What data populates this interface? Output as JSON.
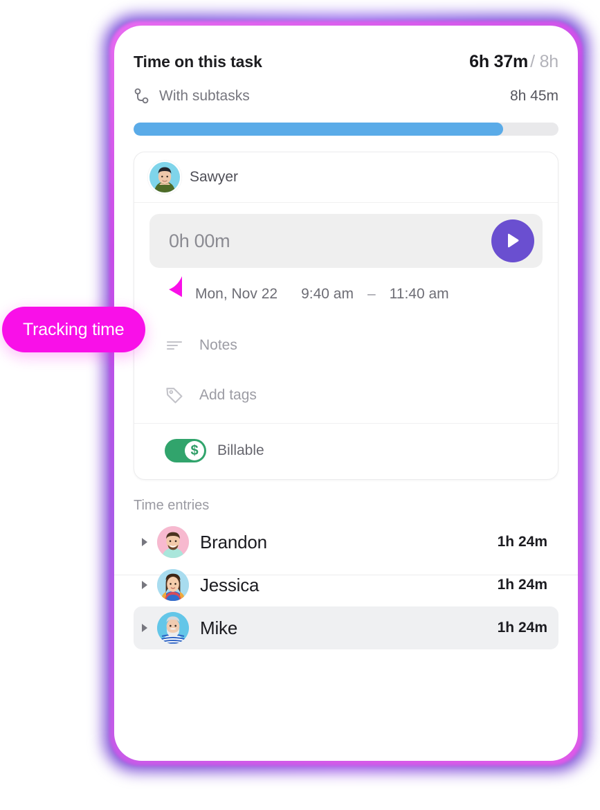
{
  "header": {
    "title": "Time on this task",
    "time_spent": "6h 37m",
    "time_estimate": "/ 8h",
    "subtasks_label": "With subtasks",
    "subtasks_total": "8h 45m",
    "subtasks_icon": "subtask-branch-icon"
  },
  "progress": {
    "percent": 87,
    "fill_color": "#5aabe8",
    "track_color": "#e9e9eb"
  },
  "active_entry": {
    "user": "Sawyer",
    "timer_value": "0h 00m",
    "play_icon": "play-icon",
    "play_button_color": "#6a4fd0",
    "date": "Mon, Nov 22",
    "start_time": "9:40 am",
    "dash": "–",
    "end_time": "11:40 am",
    "notes_label": "Notes",
    "notes_icon": "notes-lines-icon",
    "tags_label": "Add tags",
    "tags_icon": "tag-icon",
    "billable_label": "Billable",
    "billable_on": true,
    "billable_color": "#31a46c",
    "billable_knob_glyph": "$"
  },
  "time_entries": {
    "title": "Time entries",
    "rows": [
      {
        "name": "Brandon",
        "duration": "1h 24m",
        "caret": "caret-right-icon",
        "avatar": "avatar-brandon",
        "active": false
      },
      {
        "name": "Jessica",
        "duration": "1h 24m",
        "caret": "caret-right-icon",
        "avatar": "avatar-jessica",
        "active": false
      },
      {
        "name": "Mike",
        "duration": "1h 24m",
        "caret": "caret-right-icon",
        "avatar": "avatar-mike",
        "active": true
      }
    ]
  },
  "callout": {
    "text": "Tracking time",
    "color": "#f910e8"
  }
}
